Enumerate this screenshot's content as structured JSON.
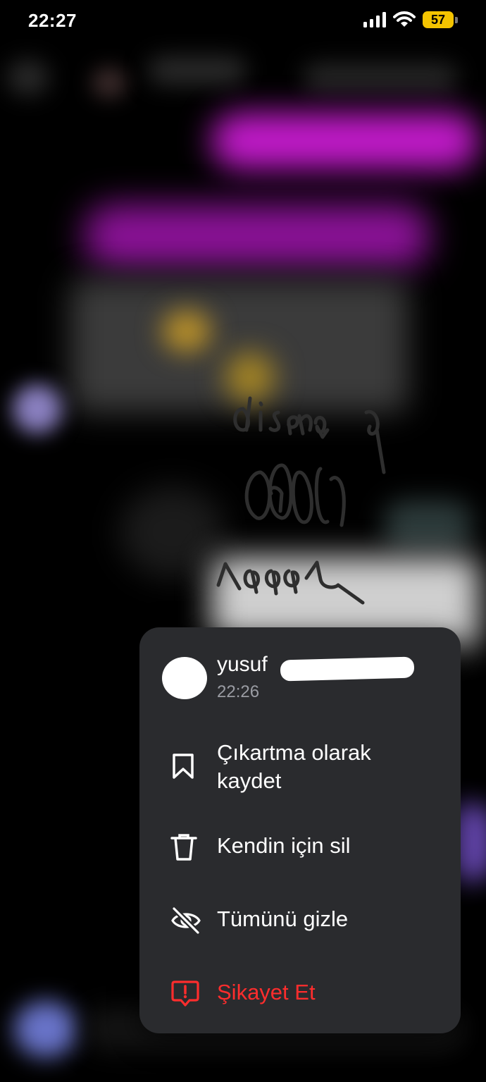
{
  "status_bar": {
    "time": "22:27",
    "battery": "57",
    "battery_color": "#f4c400"
  },
  "context_menu": {
    "user_name": "yusuf",
    "timestamp": "22:26",
    "items": [
      {
        "label": "Çıkartma olarak\nkaydet",
        "icon": "bookmark-icon"
      },
      {
        "label": "Kendin için sil",
        "icon": "trash-icon"
      },
      {
        "label": "Tümünü gizle",
        "icon": "eye-off-icon"
      },
      {
        "label": "Şikayet Et",
        "icon": "report-icon",
        "color": "#ff2d2d"
      }
    ]
  },
  "background": {
    "sent_bubble_color": "#c01ac8",
    "handwritten_note": "dilsene\nsana"
  }
}
